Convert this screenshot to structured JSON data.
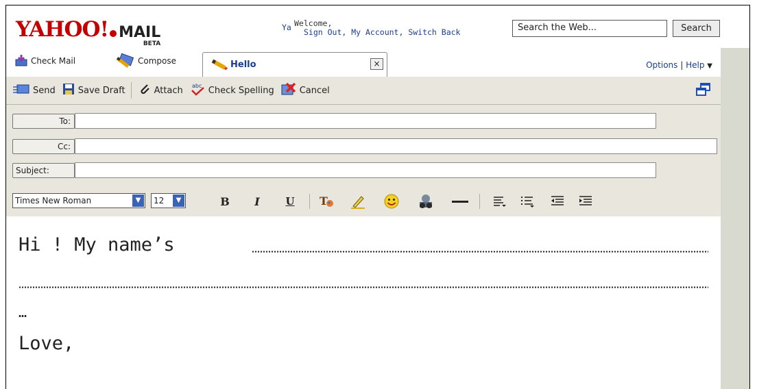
{
  "brand": {
    "logo_text": "YAHOO!",
    "mail_text": "MAIL",
    "beta_text": "BETA"
  },
  "account": {
    "ya": "Ya",
    "welcome": "Welcome,",
    "links": "Sign Out, My Account, Switch Back"
  },
  "search": {
    "placeholder": "Search the Web...",
    "button": "Search"
  },
  "tabs": {
    "check_mail": "Check Mail",
    "compose": "Compose",
    "active": "Hello",
    "close": "×"
  },
  "options": {
    "options_label": "Options",
    "divider": "|",
    "help_label": "Help",
    "help_arrow": "▼"
  },
  "toolbar": {
    "send": "Send",
    "save_draft": "Save Draft",
    "attach": "Attach",
    "check_spelling": "Check Spelling",
    "cancel": "Cancel"
  },
  "fields": {
    "to_label": "To:",
    "cc_label": "Cc:",
    "subject_label": "Subject:",
    "to_value": "",
    "cc_value": "",
    "subject_value": ""
  },
  "format": {
    "font_family": "Times New Roman",
    "font_size": "12",
    "bold": "B",
    "italic": "I",
    "underline": "U"
  },
  "body": {
    "line1": "Hi ! My name’s",
    "line3": "…",
    "line4": "Love,"
  },
  "colors": {
    "brand_red": "#c40000",
    "link_blue": "#1a3e8f",
    "toolbar_bg": "#e9e7dd",
    "side_panel": "#d8d9cf"
  },
  "icons": [
    "check-mail-icon",
    "compose-icon",
    "pencil-icon",
    "send-icon",
    "save-icon",
    "paperclip-icon",
    "spellcheck-icon",
    "cancel-icon",
    "popout-icon",
    "text-color-icon",
    "highlight-icon",
    "smiley-icon",
    "insert-image-icon",
    "horizontal-rule-icon",
    "align-icon",
    "bullet-list-icon",
    "outdent-icon",
    "indent-icon"
  ]
}
